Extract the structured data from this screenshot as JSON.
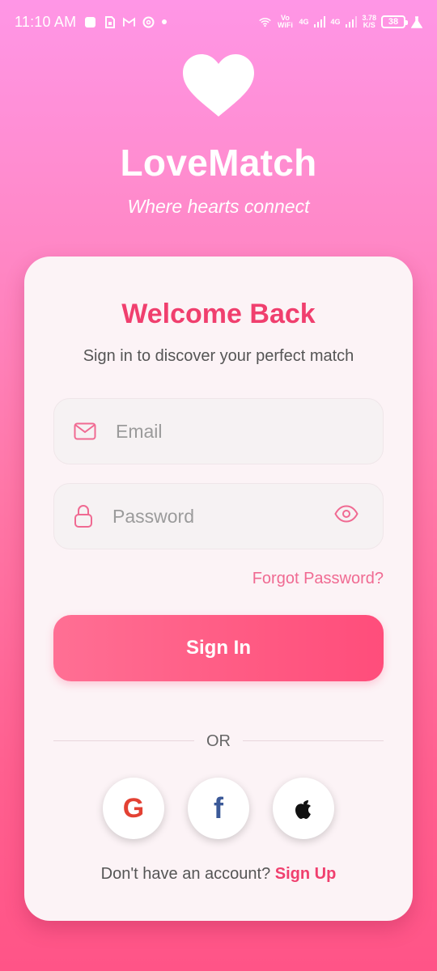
{
  "status_bar": {
    "time": "11:10 AM",
    "volte_label": "Vo WiFi",
    "net_label_1": "4G",
    "net_label_2": "4G",
    "speed_value": "3.78",
    "speed_unit": "K/S",
    "battery": "38"
  },
  "header": {
    "app_name": "LoveMatch",
    "tagline": "Where hearts connect",
    "logo_icon": "heart-icon"
  },
  "card": {
    "title": "Welcome Back",
    "subtitle": "Sign in to discover your perfect match",
    "email_placeholder": "Email",
    "password_placeholder": "Password",
    "forgot_password": "Forgot Password?",
    "sign_in_label": "Sign In",
    "divider_text": "OR",
    "social": {
      "google_glyph": "G",
      "facebook_glyph": "f",
      "apple_icon": "apple-icon"
    },
    "signup_prompt": "Don't have an account?",
    "signup_link": "Sign Up"
  },
  "colors": {
    "accent": "#f03f6e",
    "link": "#f06a92",
    "button": "#ff5a83",
    "background_top": "#ff96e6",
    "background_bottom": "#ff5487"
  }
}
